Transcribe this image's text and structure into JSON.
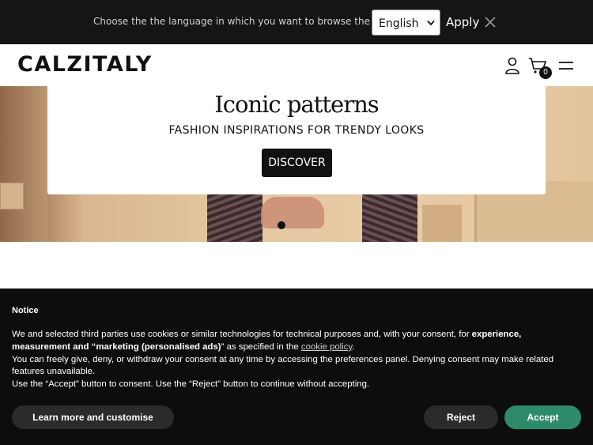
{
  "language_bar": {
    "prompt": "Choose the the language in which you want to browse the site.",
    "selected_language": "English",
    "apply_label": "Apply"
  },
  "header": {
    "logo": "CALZITALY",
    "cart_count": "0"
  },
  "hero": {
    "title": "Iconic patterns",
    "subtitle": "FASHION INSPIRATIONS FOR TRENDY LOOKS",
    "cta_label": "DISCOVER"
  },
  "cookie_notice": {
    "title": "Notice",
    "line1_start": "We and selected third parties use cookies or similar technologies for technical purposes and, with your consent, for ",
    "line1_bold": "experience, measurement and “marketing (personalised ads)",
    "line1_mid": "” as specified in the ",
    "link_text": "cookie policy",
    "line1_end": ".",
    "line2": "You can freely give, deny, or withdraw your consent at any time by accessing the preferences panel. Denying consent may make related features unavailable.",
    "line3": "Use the “Accept” button to consent. Use the “Reject” button to continue without accepting.",
    "learn_more_label": "Learn more and customise",
    "reject_label": "Reject",
    "accept_label": "Accept"
  },
  "colors": {
    "top_bar": "#151515",
    "accent_accept": "#2e8b6a",
    "cookie_bg": "#0d0d0d"
  },
  "icons": [
    "close-icon",
    "chevron-down-icon",
    "user-icon",
    "cart-icon",
    "menu-icon"
  ]
}
